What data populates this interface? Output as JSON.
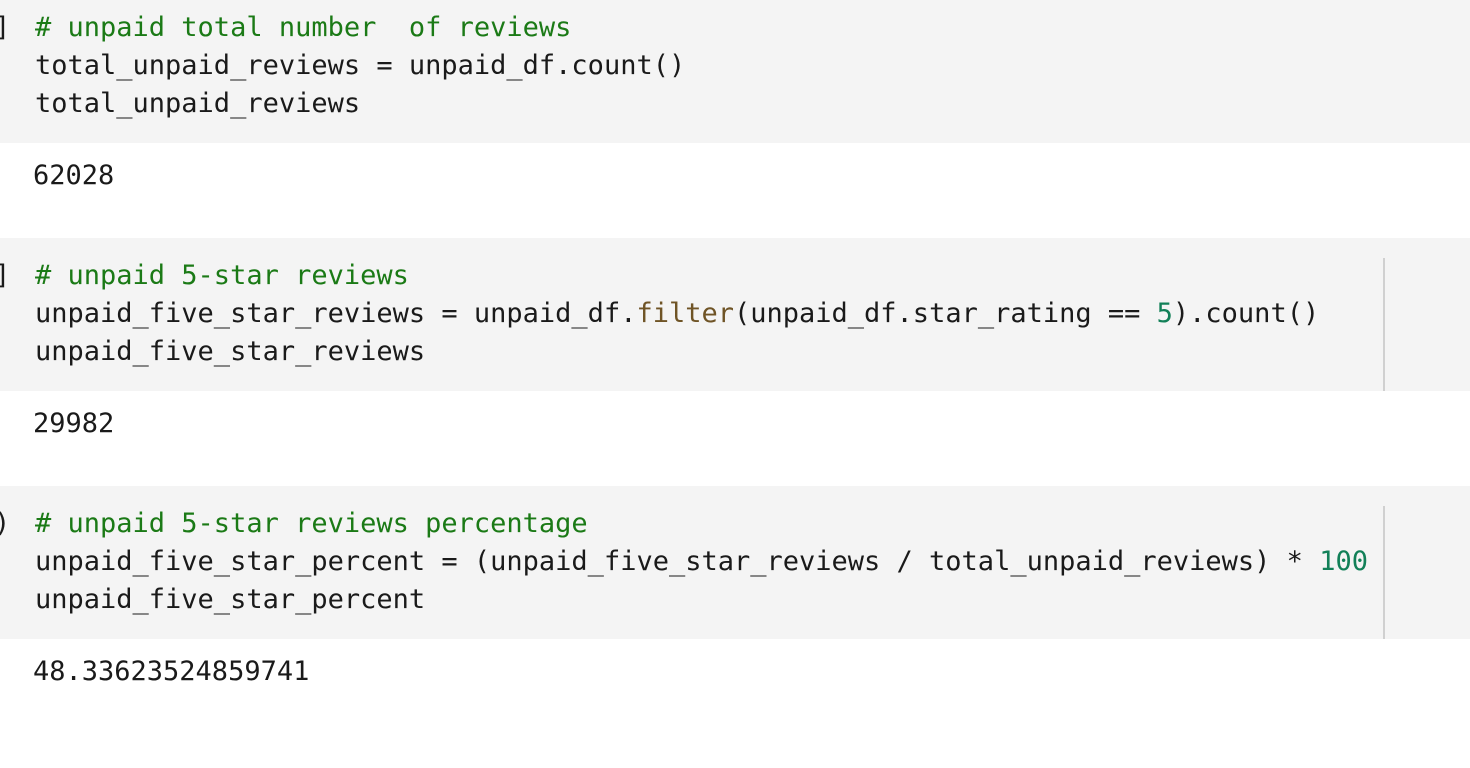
{
  "cells": [
    {
      "prompt": "]",
      "comment": "# unpaid total number  of reviews",
      "line2": "total_unpaid_reviews = unpaid_df.count()",
      "line3": "total_unpaid_reviews",
      "output": "62028"
    },
    {
      "prompt": "]",
      "comment": "# unpaid 5-star reviews",
      "line2_a": "unpaid_five_star_reviews = unpaid_df.",
      "line2_b": "filter",
      "line2_c": "(unpaid_df.star_rating == ",
      "line2_d": "5",
      "line2_e": ").count()",
      "line3": "unpaid_five_star_reviews",
      "output": "29982"
    },
    {
      "prompt": ")",
      "comment": "# unpaid 5-star reviews percentage",
      "line2_a": "unpaid_five_star_percent = (unpaid_five_star_reviews / total_unpaid_reviews) * ",
      "line2_b": "100",
      "line3": "unpaid_five_star_percent",
      "output": "48.33623524859741"
    }
  ],
  "colors": {
    "comment": "#1b7a16",
    "builtin": "#6f5426",
    "number": "#128058",
    "code_bg": "#f4f4f4"
  }
}
